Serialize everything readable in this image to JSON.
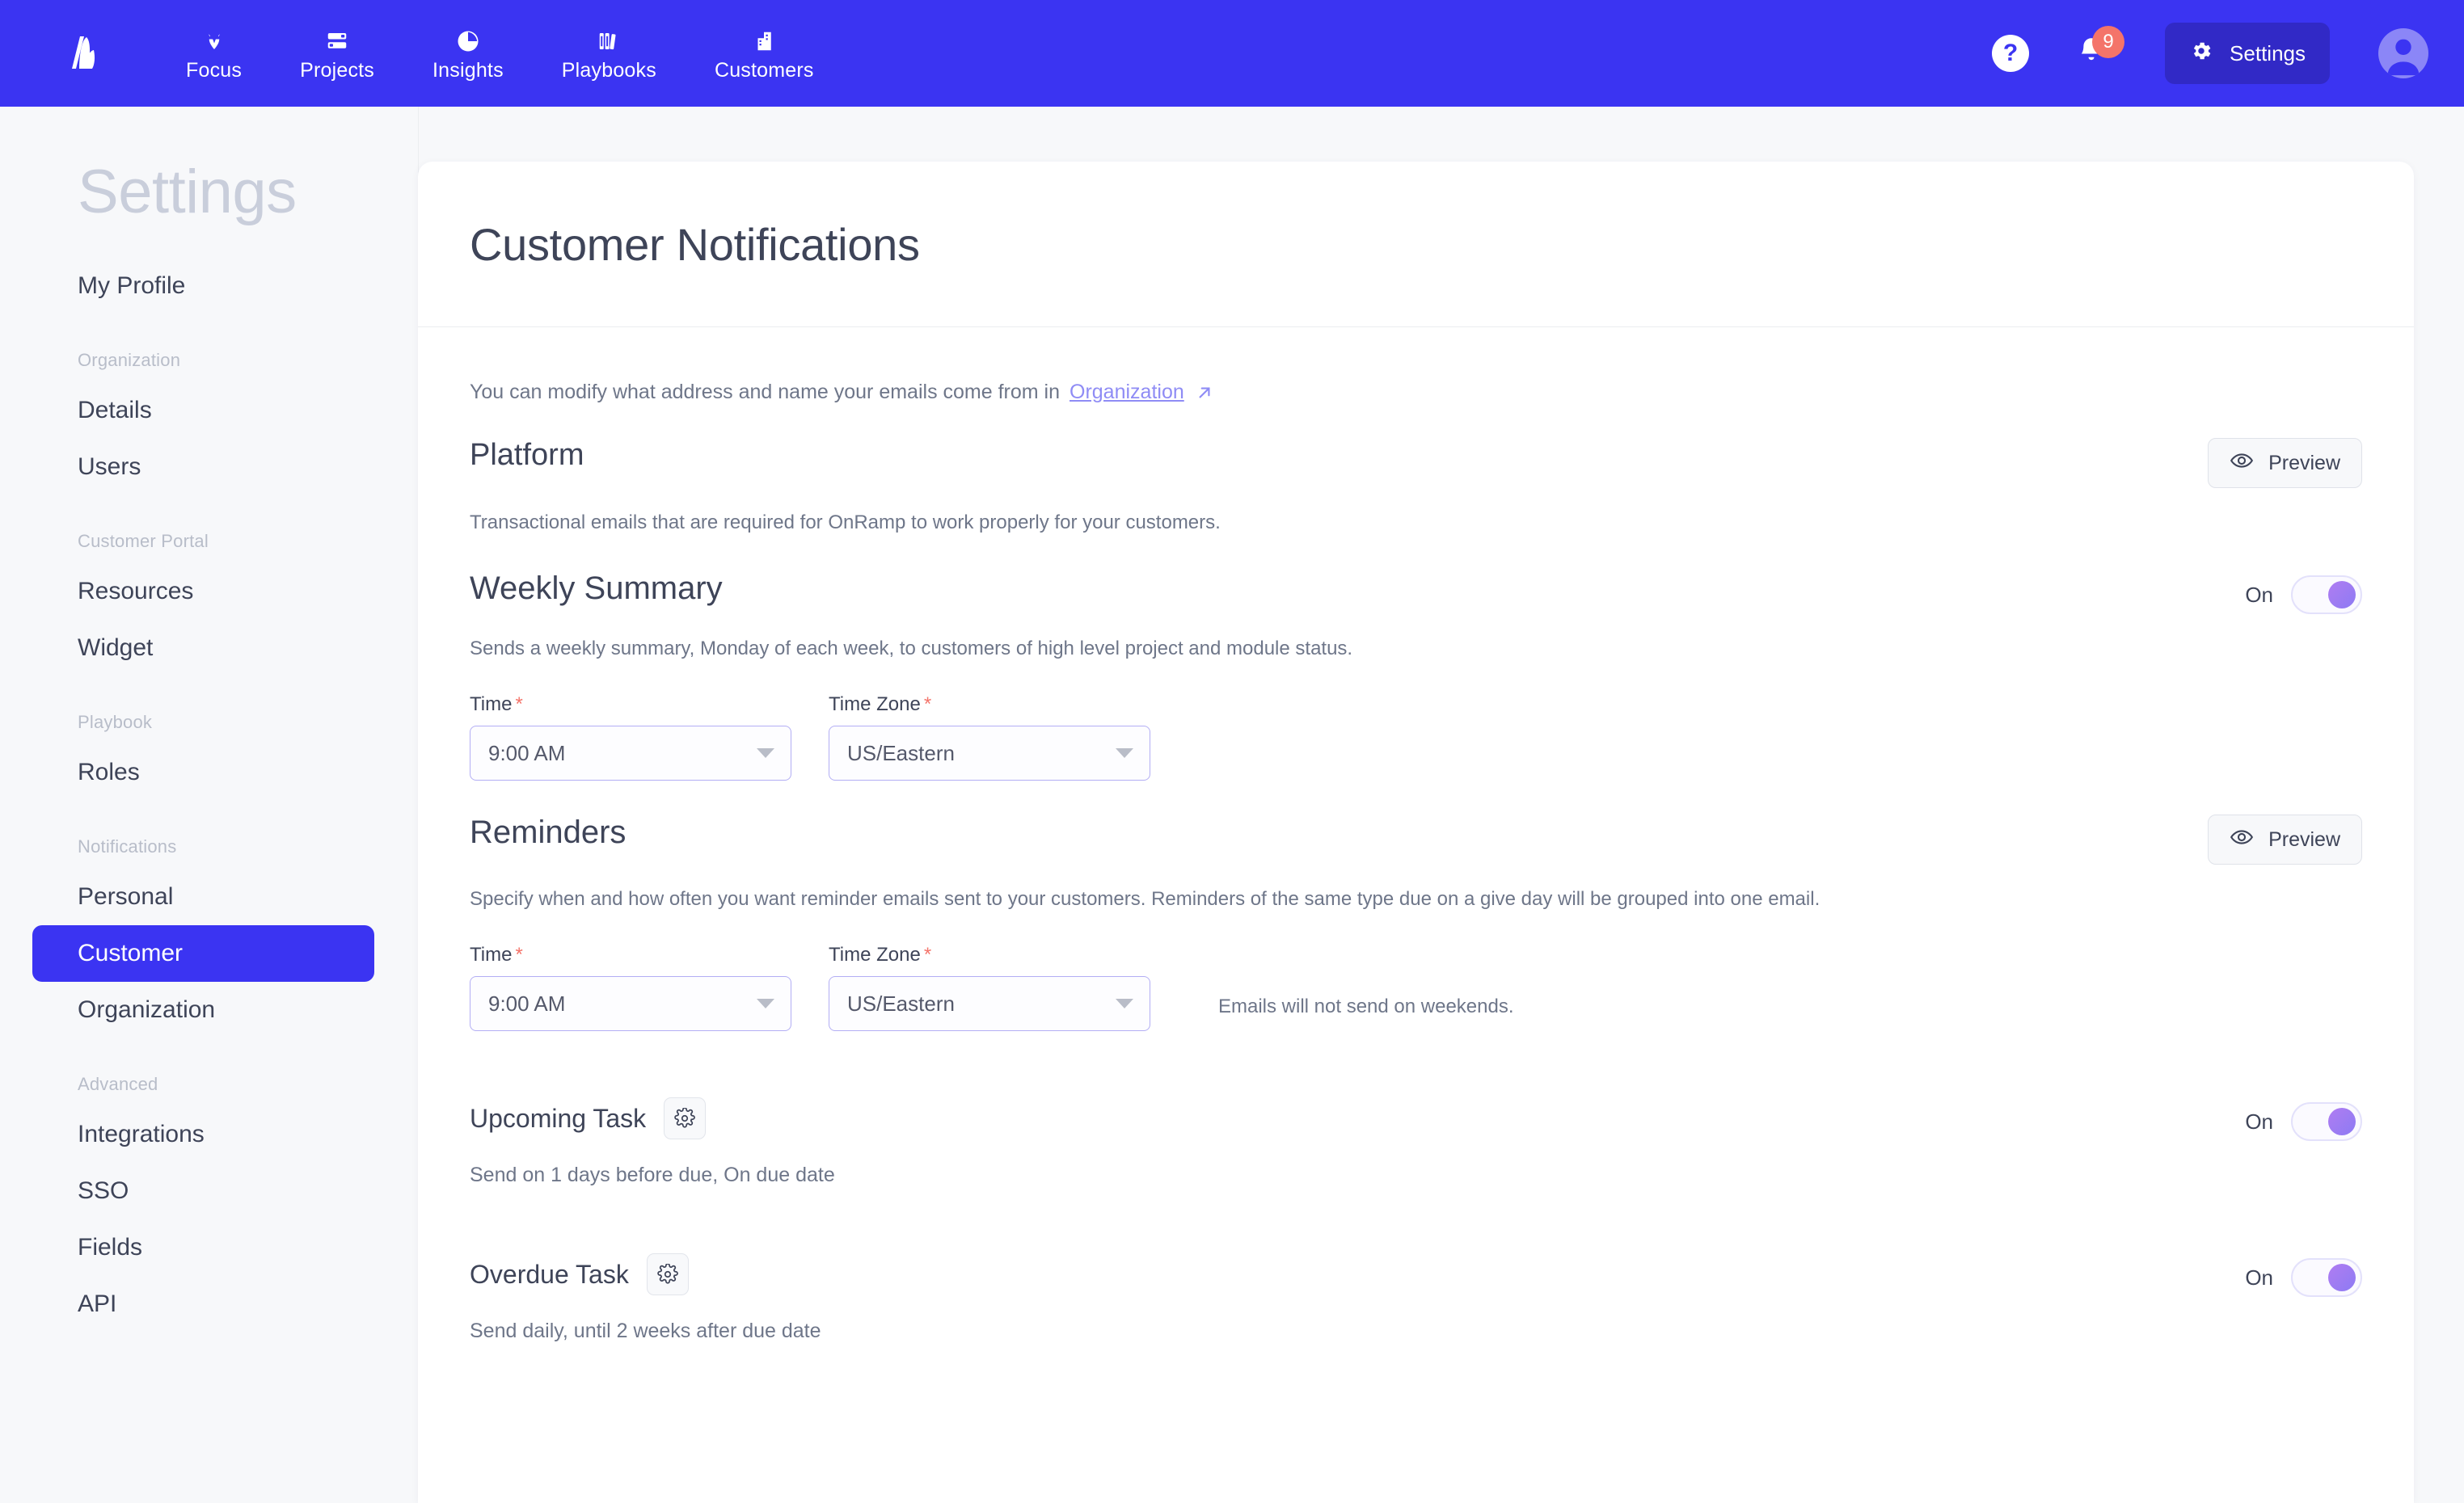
{
  "topnav": {
    "brand_icon": "onramp-logo-icon",
    "items": [
      {
        "label": "Focus",
        "icon": "focus-icon"
      },
      {
        "label": "Projects",
        "icon": "projects-icon"
      },
      {
        "label": "Insights",
        "icon": "insights-pie-icon"
      },
      {
        "label": "Playbooks",
        "icon": "playbooks-books-icon"
      },
      {
        "label": "Customers",
        "icon": "customers-building-icon"
      }
    ],
    "help_icon": "question-mark-icon",
    "bell_icon": "bell-icon",
    "notification_count": "9",
    "settings_label": "Settings",
    "settings_icon": "gear-icon",
    "avatar_icon": "user-avatar-icon",
    "colors": {
      "bar": "#3b34f2",
      "settings_button": "#3129c6",
      "badge": "#f4746a",
      "avatar": "#8b86f7"
    }
  },
  "sidebar": {
    "wordmark": "Settings",
    "items": [
      {
        "label": "My Profile",
        "type": "item",
        "active": false
      },
      {
        "label": "Organization",
        "type": "group"
      },
      {
        "label": "Details",
        "type": "item",
        "active": false
      },
      {
        "label": "Users",
        "type": "item",
        "active": false
      },
      {
        "label": "Customer Portal",
        "type": "group"
      },
      {
        "label": "Resources",
        "type": "item",
        "active": false
      },
      {
        "label": "Widget",
        "type": "item",
        "active": false
      },
      {
        "label": "Playbook",
        "type": "group"
      },
      {
        "label": "Roles",
        "type": "item",
        "active": false
      },
      {
        "label": "Notifications",
        "type": "group"
      },
      {
        "label": "Personal",
        "type": "item",
        "active": false
      },
      {
        "label": "Customer",
        "type": "item",
        "active": true
      },
      {
        "label": "Organization",
        "type": "item",
        "active": false
      },
      {
        "label": "Advanced",
        "type": "group"
      },
      {
        "label": "Integrations",
        "type": "item",
        "active": false
      },
      {
        "label": "SSO",
        "type": "item",
        "active": false
      },
      {
        "label": "Fields",
        "type": "item",
        "active": false
      },
      {
        "label": "API",
        "type": "item",
        "active": false
      }
    ],
    "active_color": "#3b34f2"
  },
  "page": {
    "title": "Customer Notifications",
    "modify_text": "You can modify what address and name your emails come from in",
    "modify_link": "Organization",
    "external_link_icon": "external-link-arrow-icon",
    "link_color": "#8f8cf5"
  },
  "platform": {
    "title": "Platform",
    "description": "Transactional emails that are required for OnRamp to work properly for your customers.",
    "preview_label": "Preview",
    "preview_icon": "eye-icon"
  },
  "weekly_summary": {
    "title": "Weekly Summary",
    "description": "Sends a weekly summary, Monday of each week, to customers of high level project and module status.",
    "toggle_state": "On",
    "time_label": "Time",
    "time_value": "9:00 AM",
    "timezone_label": "Time Zone",
    "timezone_value": "US/Eastern",
    "required_mark": "*"
  },
  "reminders": {
    "title": "Reminders",
    "description": "Specify when and how often you want reminder emails sent to your customers. Reminders of the same type due on a give day will be grouped into one email.",
    "preview_label": "Preview",
    "preview_icon": "eye-icon",
    "time_label": "Time",
    "time_value": "9:00 AM",
    "timezone_label": "Time Zone",
    "timezone_value": "US/Eastern",
    "required_mark": "*",
    "weekend_note": "Emails will not send on weekends.",
    "tasks": [
      {
        "title": "Upcoming Task",
        "gear_icon": "gear-icon",
        "description": "Send on 1 days before due, On due date",
        "toggle_state": "On"
      },
      {
        "title": "Overdue Task",
        "gear_icon": "gear-icon",
        "description": "Send daily, until 2 weeks after due date",
        "toggle_state": "On"
      }
    ]
  }
}
